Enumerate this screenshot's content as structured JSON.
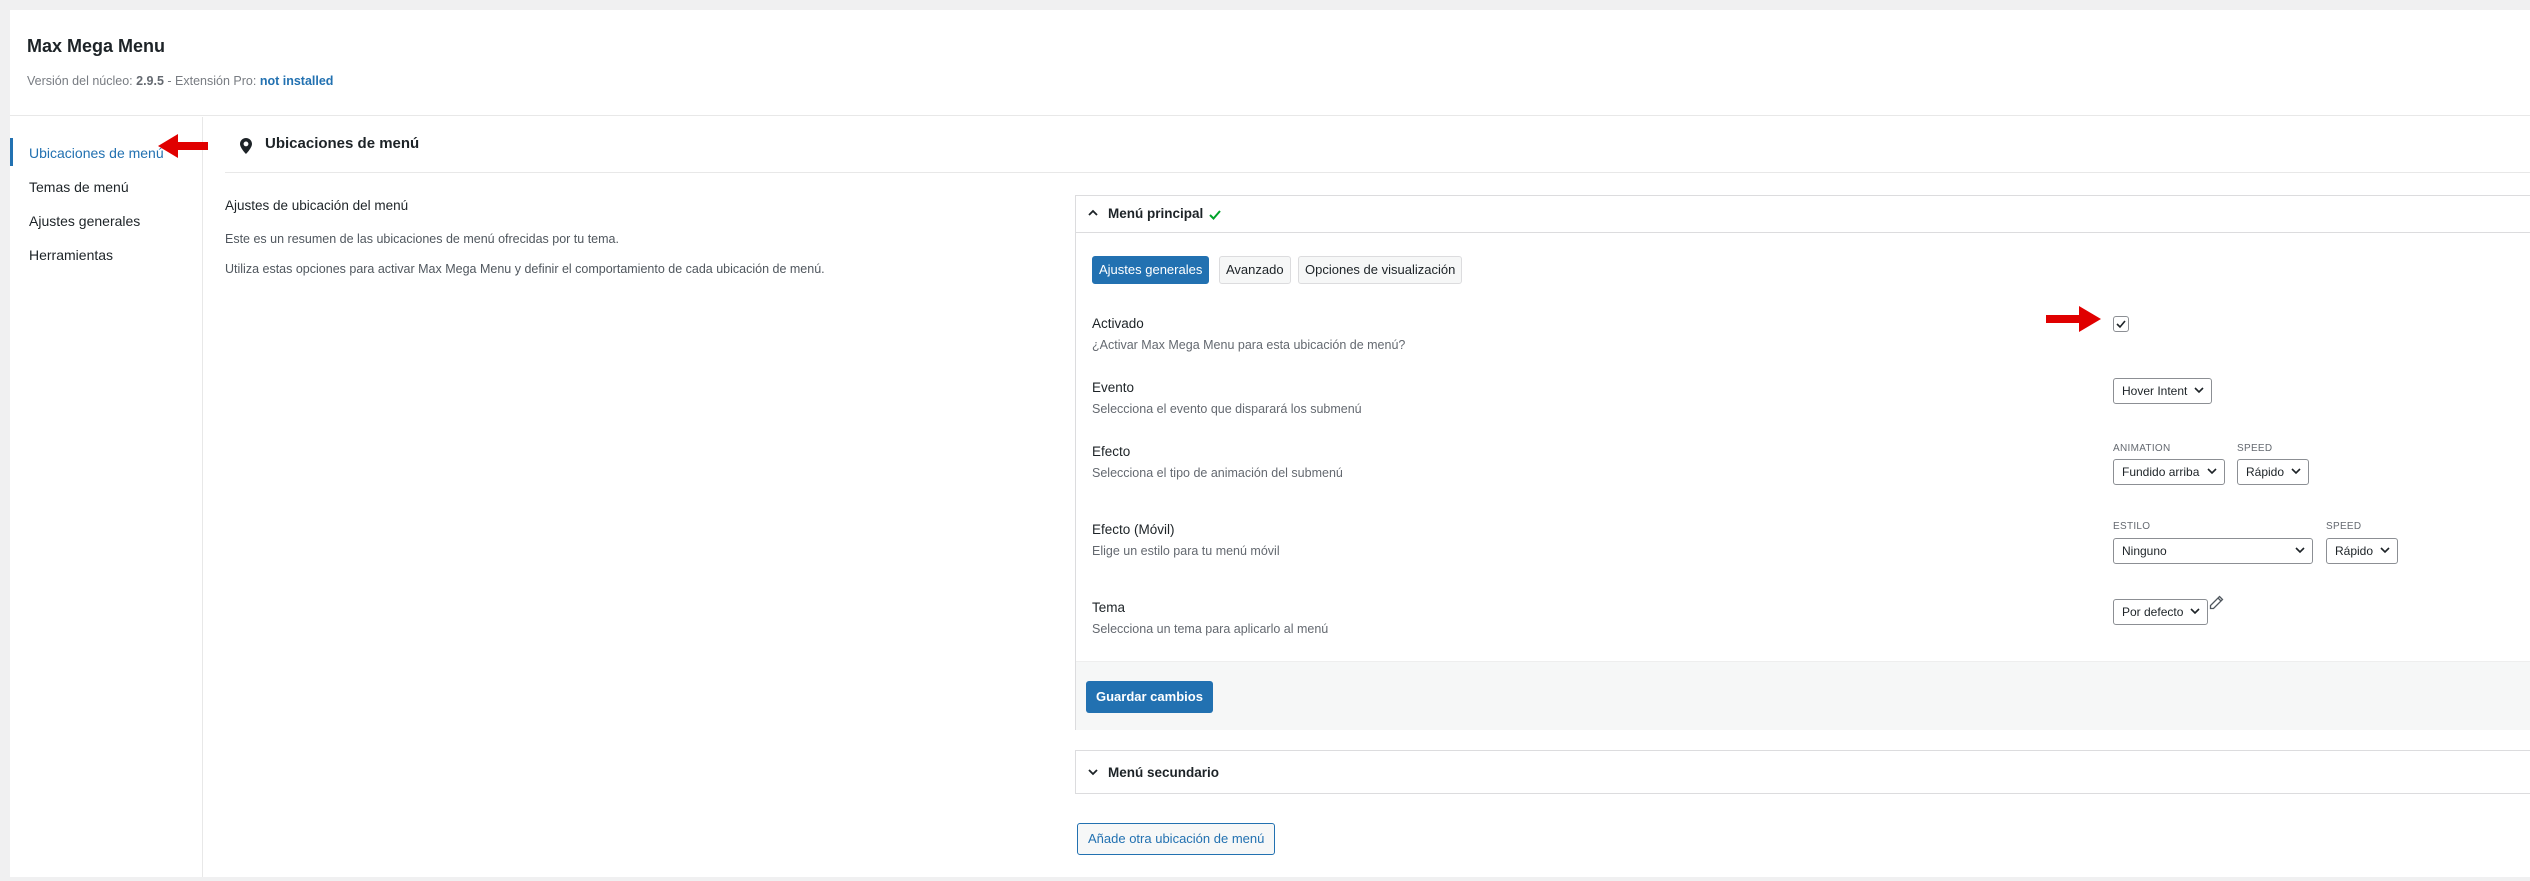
{
  "header": {
    "title": "Max Mega Menu",
    "version_label": "Versión del núcleo:",
    "version_value": "2.9.5",
    "pro_label": " - Extensión Pro:",
    "pro_value": "not installed"
  },
  "sidebar": {
    "items": [
      {
        "label": "Ubicaciones de menú"
      },
      {
        "label": "Temas de menú"
      },
      {
        "label": "Ajustes generales"
      },
      {
        "label": "Herramientas"
      }
    ]
  },
  "main": {
    "heading": "Ubicaciones de menú",
    "description_title": "Ajustes de ubicación del menú",
    "description_1": "Este es un resumen de las ubicaciones de menú ofrecidas por tu tema.",
    "description_2": "Utiliza estas opciones para activar Max Mega Menu y definir el comportamiento de cada ubicación de menú."
  },
  "panel": {
    "title": "Menú principal",
    "status_icon": "check-icon",
    "status_color": "#00a32a",
    "tabs": [
      {
        "label": "Ajustes generales",
        "active": true
      },
      {
        "label": "Avanzado",
        "active": false
      },
      {
        "label": "Opciones de visualización",
        "active": false
      }
    ],
    "rows": {
      "activado": {
        "label": "Activado",
        "sub": "¿Activar Max Mega Menu para esta ubicación de menú?",
        "checked": true
      },
      "evento": {
        "label": "Evento",
        "sub": "Selecciona el evento que disparará los submenú",
        "value": "Hover Intent"
      },
      "efecto": {
        "label": "Efecto",
        "sub": "Selecciona el tipo de animación del submenú",
        "animation_label": "ANIMATION",
        "animation_value": "Fundido arriba",
        "speed_label": "SPEED",
        "speed_value": "Rápido"
      },
      "efecto_movil": {
        "label": "Efecto (Móvil)",
        "sub": "Elige un estilo para tu menú móvil",
        "style_label": "ESTILO",
        "style_value": "Ninguno",
        "speed_label": "SPEED",
        "speed_value": "Rápido"
      },
      "tema": {
        "label": "Tema",
        "sub": "Selecciona un tema para aplicarlo al menú",
        "value": "Por defecto"
      }
    },
    "save_label": "Guardar cambios"
  },
  "panel2": {
    "title": "Menú secundario"
  },
  "add_location_label": "Añade otra ubicación de menú",
  "colors": {
    "accent": "#2271b1",
    "annotation_arrow": "#e00000"
  }
}
